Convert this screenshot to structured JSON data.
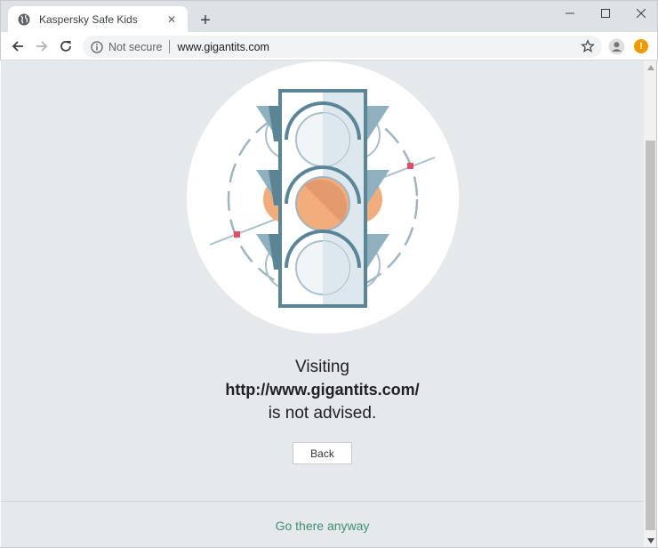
{
  "browser": {
    "tab": {
      "title": "Kaspersky Safe Kids",
      "close_glyph": "✕",
      "favicon": "globe-icon"
    },
    "new_tab_glyph": "+",
    "window_controls": {
      "minimize": "minimize-icon",
      "maximize": "maximize-icon",
      "close": "close-icon"
    },
    "toolbar": {
      "security_label": "Not secure",
      "url": "www.gigantits.com",
      "icons": [
        "back-arrow-icon",
        "forward-arrow-icon",
        "reload-icon",
        "info-icon",
        "star-icon",
        "profile-icon",
        "extension-alert-icon"
      ],
      "alert_glyph": "!"
    }
  },
  "page": {
    "message": {
      "line1": "Visiting",
      "url": "http://www.gigantits.com/",
      "line3": "is not advised."
    },
    "back_button": "Back",
    "go_anyway_link": "Go there anyway",
    "colors": {
      "background": "#e6e9ec",
      "frame": "#5a8597",
      "amber": "#f3ad7c",
      "link": "#3f8f76",
      "accent_dot": "#e1506a"
    }
  }
}
